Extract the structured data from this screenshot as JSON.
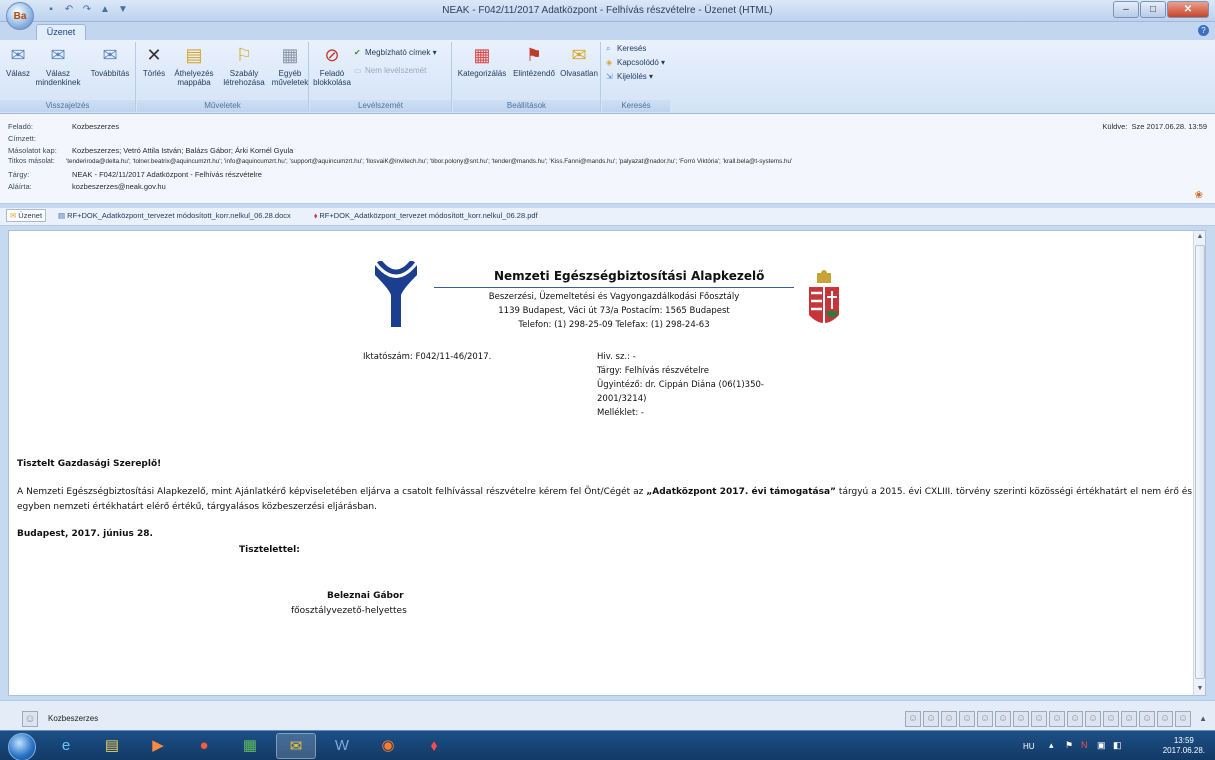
{
  "window": {
    "title": "NEAK - F042/11/2017 Adatközpont - Felhívás részvételre - Üzenet (HTML)",
    "tab": "Üzenet",
    "logo_letters": "Ba"
  },
  "ribbon": {
    "groups": {
      "respond": "Visszajelzés",
      "actions": "Műveletek",
      "junk": "Levélszemét",
      "options": "Beállítások",
      "find": "Keresés"
    },
    "buttons": {
      "reply": "Válasz",
      "reply_all": "Válasz mindenkinek",
      "forward": "Továbbítás",
      "delete": "Törlés",
      "move": "Áthelyezés mappába",
      "rules": "Szabály létrehozása",
      "other": "Egyéb műveletek",
      "block": "Feladó blokkolása",
      "safe_lists": "Megbízható címek",
      "not_junk": "Nem levélszemét",
      "categorize": "Kategorizálás",
      "follow_up": "Elintézendő",
      "unread": "Olvasatlan",
      "find": "Keresés",
      "related": "Kapcsolódó",
      "select": "Kijelölés"
    }
  },
  "header": {
    "labels": {
      "from": "Feladó:",
      "to": "Címzett:",
      "cc": "Másolatot kap:",
      "bcc": "Titkos másolat:",
      "subject": "Tárgy:",
      "signed": "Aláírta:",
      "sent": "Küldve:"
    },
    "from": "Kozbeszerzes",
    "to": "",
    "cc": "Kozbeszerzes; Vetró Attila István; Balázs Gábor; Árki Kornél Gyula",
    "bcc": "'tenderiroda@delta.hu'; 'tolner.beatrix@aquincumzrt.hu'; 'info@aquincumzrt.hu'; 'support@aquincumzrt.hu'; 'llosvaiK@invitech.hu'; 'tibor.polony@snt.hu'; 'tender@mands.hu'; 'Kiss.Fanni@mands.hu'; 'palyazat@nador.hu'; 'Forró Viktória'; 'krall.bela@t-systems.hu'",
    "subject": "NEAK - F042/11/2017 Adatközpont - Felhívás részvételre",
    "signed": "kozbeszerzes@neak.gov.hu",
    "sent": "Sze 2017.06.28. 13:59"
  },
  "attachments": {
    "message": "Üzenet",
    "docx": "RF+DOK_Adatközpont_tervezet módosított_korr.nelkul_06.28.docx",
    "pdf": "RF+DOK_Adatközpont_tervezet módosított_korr.nelkul_06.28.pdf"
  },
  "letter": {
    "org_name": "Nemzeti Egészségbiztosítási Alapkezelő",
    "org_dept": "Beszerzési, Üzemeltetési és Vagyongazdálkodási Főosztály",
    "org_address": "1139 Budapest, Váci út 73/a Postacím: 1565 Budapest",
    "org_phone": "Telefon: (1) 298-25-09 Telefax: (1) 298-24-63",
    "iktatoszam": "Iktatószám: F042/11-46/2017.",
    "hiv_sz": "Hiv. sz.: -",
    "targy": "Tárgy: Felhívás részvételre",
    "ugyintezo_1": "Ügyintéző: dr. Cippán Diána (06(1)350-",
    "ugyintezo_2": "2001/3214)",
    "melleklet": "Melléklet: -",
    "greeting": "Tisztelt Gazdasági Szereplő!",
    "para_before": "A Nemzeti Egészségbiztosítási Alapkezelő, mint Ajánlatkérő képviseletében eljárva a csatolt felhívással részvételre kérem fel Önt/Cégét az ",
    "para_bold": "„Adatközpont 2017. évi támogatása”",
    "para_after": " tárgyú a 2015. évi CXLIII. törvény szerinti közösségi értékhatárt el nem érő és egyben nemzeti értékhatárt elérő értékű, tárgyalásos közbeszerzési eljárásban.",
    "place_date": "Budapest, 2017. június 28.",
    "closing": "Tisztelettel:",
    "signer_name": "Beleznai Gábor",
    "signer_title": "főosztályvezető-helyettes"
  },
  "people_pane": {
    "name": "Kozbeszerzes"
  },
  "taskbar": {
    "language": "HU",
    "time": "13:59",
    "date": "2017.06.28."
  }
}
